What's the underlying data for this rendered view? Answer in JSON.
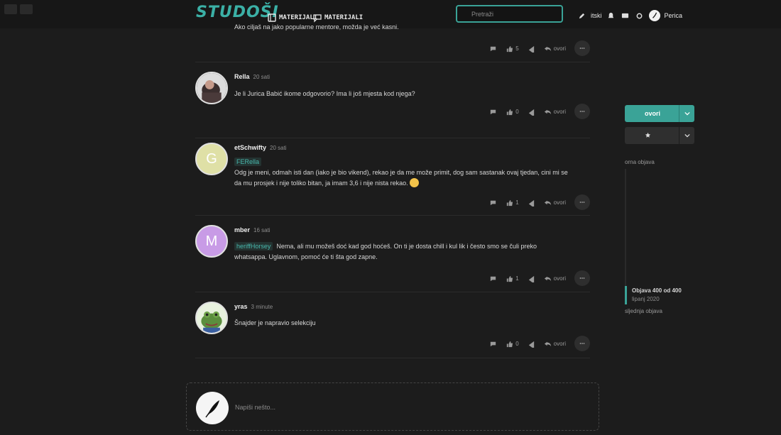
{
  "header": {
    "logo": "STUDOŠI",
    "nav": [
      {
        "label": "MATERIJALI",
        "icon": "book-icon"
      },
      {
        "label": "MATERIJALI",
        "icon": "chat-icon"
      }
    ],
    "search_placeholder": "Pretraži",
    "username_partial": "itski",
    "user": "Perica"
  },
  "prev_post": {
    "text": "Ako ciljaš na jako popularne mentore, možda je već kasni.",
    "like_count": "5",
    "reply_label": "ovori"
  },
  "posts": [
    {
      "author": "Rella",
      "time": "20 sati",
      "mention": "",
      "text": "Je li Jurica Babić ikome odgovorio? Ima li još mjesta kod njega?",
      "like_count": "0",
      "reply_label": "ovori",
      "avatar_letter": "",
      "avatar_color": "#333"
    },
    {
      "author": "etSchwifty",
      "time": "20 sati",
      "mention": "FERella",
      "text": "Odg je meni, odmah isti dan (iako je bio vikend), rekao je da me može primit, dog sam sastanak ovaj tjedan, cini mi se da mu prosjek i nije toliko bitan, ja imam 3,6 i nije nista rekao.",
      "like_count": "1",
      "reply_label": "ovori",
      "avatar_letter": "G",
      "avatar_color": "#dfe0a6"
    },
    {
      "author": "mber",
      "time": "16 sati",
      "mention": "heriffHorsey",
      "text": "Nema, ali mu možeš doć kad god hoćeš. On ti je dosta chill i kul lik i često smo se čuli preko whatsappa. Uglavnom, pomoć će ti šta god zapne.",
      "like_count": "1",
      "reply_label": "ovori",
      "avatar_letter": "M",
      "avatar_color": "#c89be6"
    },
    {
      "author": "yras",
      "time": "3 minute",
      "mention": "",
      "text": "Šnajder je napravio selekciju",
      "like_count": "0",
      "reply_label": "ovori",
      "avatar_letter": "",
      "avatar_color": "#5b8e3e"
    }
  ],
  "composer": {
    "placeholder": "Napiši nešto..."
  },
  "sidebar": {
    "primary_label": "ovori",
    "top_link": "orna objava",
    "position_label": "Objava 400 od 400",
    "position_date": "lipanj 2020",
    "bottom_link": "sljednja objava"
  },
  "colors": {
    "accent": "#3aa397",
    "background": "#1c1c1c",
    "mention": "#48b8ad"
  }
}
